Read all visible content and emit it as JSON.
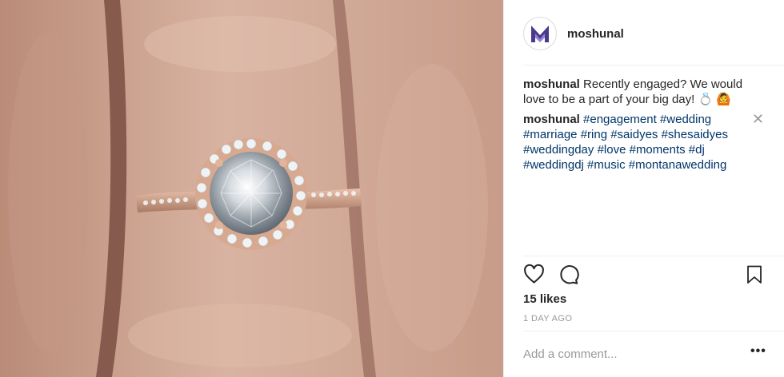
{
  "post": {
    "username": "moshunal",
    "caption_user": "moshunal",
    "caption_text": "Recently engaged? We would love to be a part of your big day! 💍 🙆",
    "comment_user": "moshunal",
    "comment_tags": "#engagement #wedding #marriage #ring #saidyes #shesaidyes #weddingday #love #moments #dj #weddingdj #music #montanawedding",
    "likes": "15 likes",
    "time": "1 DAY AGO",
    "comment_placeholder": "Add a comment...",
    "more_label": "•••",
    "close_label": "✕"
  },
  "icons": {
    "like": "heart-icon",
    "comment": "comment-bubble-icon",
    "save": "bookmark-icon",
    "avatar": "logo-m-icon"
  },
  "colors": {
    "hashtag": "#003569",
    "muted": "#999999",
    "text": "#262626"
  }
}
